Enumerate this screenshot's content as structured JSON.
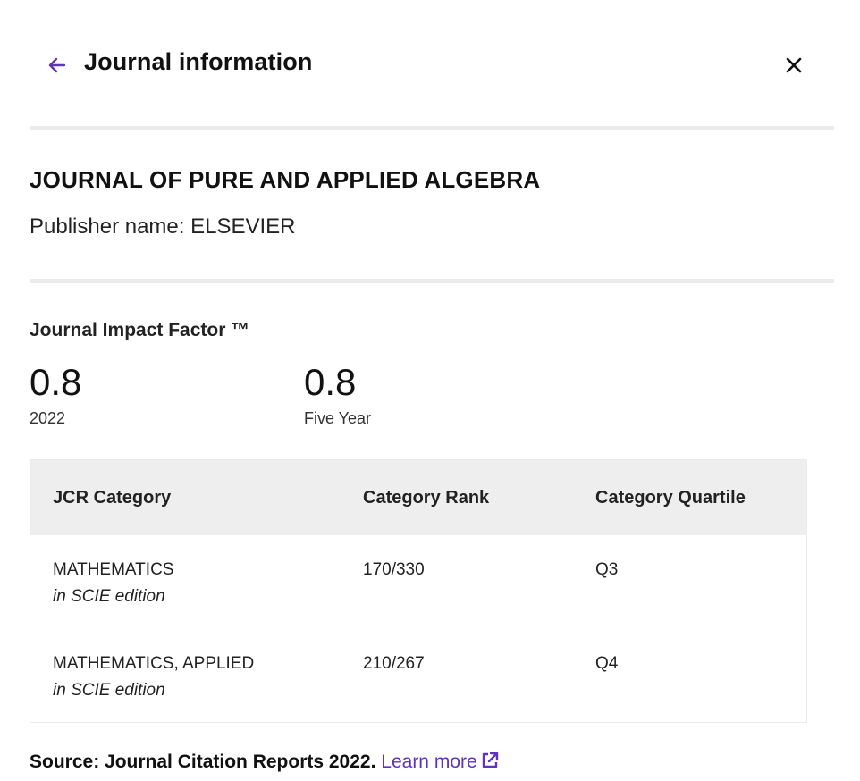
{
  "header": {
    "title": "Journal information",
    "back_icon": "arrow-left-icon",
    "close_icon": "close-icon",
    "accent_color": "#5e33bf"
  },
  "journal": {
    "name": "JOURNAL OF PURE AND APPLIED ALGEBRA",
    "publisher": "Publisher name: ELSEVIER"
  },
  "impact_factor": {
    "heading": "Journal Impact Factor ™",
    "metrics": [
      {
        "value": "0.8",
        "label": "2022"
      },
      {
        "value": "0.8",
        "label": "Five Year"
      }
    ]
  },
  "jcr_table": {
    "headers": [
      "JCR Category",
      "Category Rank",
      "Category Quartile"
    ],
    "rows": [
      {
        "category": "MATHEMATICS",
        "edition": "in SCIE edition",
        "rank": "170/330",
        "quartile": "Q3"
      },
      {
        "category": "MATHEMATICS, APPLIED",
        "edition": "in SCIE edition",
        "rank": "210/267",
        "quartile": "Q4"
      }
    ]
  },
  "footer": {
    "source_text": "Source: Journal Citation Reports  2022.",
    "learn_more": "Learn more",
    "external_icon": "external-link-icon"
  }
}
